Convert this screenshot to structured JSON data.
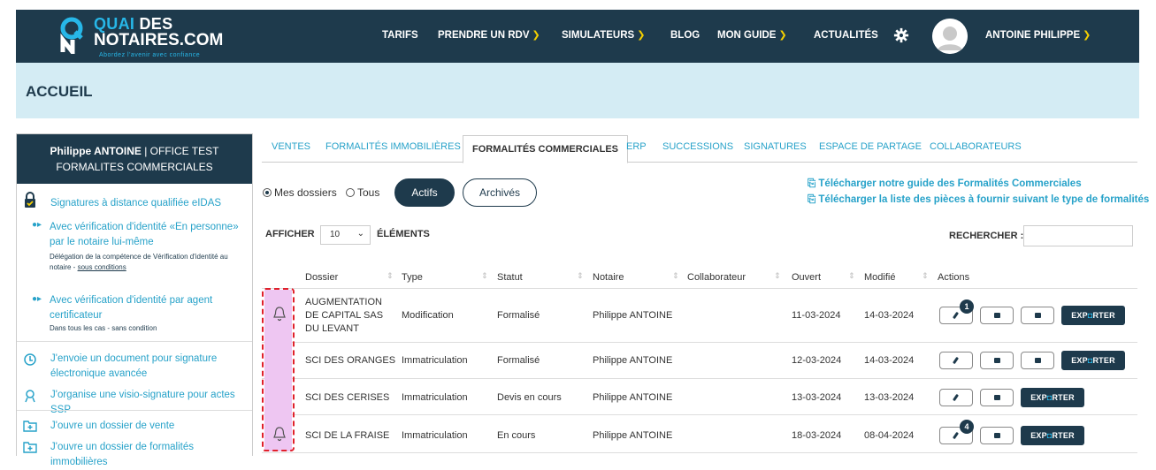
{
  "header": {
    "logo_line1_q": "QUAI",
    "logo_line1_rest": " DES",
    "logo_line2": "NOTAIRES.COM",
    "logo_tagline": "Abordez l'avenir avec confiance",
    "nav": [
      {
        "label": "TARIFS",
        "chevron": false
      },
      {
        "label": "PRENDRE UN RDV",
        "chevron": true
      },
      {
        "label": "SIMULATEURS",
        "chevron": true
      },
      {
        "label": "BLOG",
        "chevron": false
      },
      {
        "label": "MON GUIDE",
        "chevron": true
      },
      {
        "label": "ACTUALITÉS",
        "chevron": false
      }
    ],
    "settings_icon": "gear-icon",
    "user_name": "ANTOINE PHILIPPE",
    "colors": {
      "bar": "#1e3a4c",
      "accent": "#27b7e8",
      "chevron": "#f5d000"
    }
  },
  "banner": {
    "title": "ACCUEIL",
    "color": "#d4ecf4"
  },
  "sidebar": {
    "head_bold": "Philippe ANTOINE",
    "head_rest": " | OFFICE TEST FORMALITES COMMERCIALES",
    "signatures_title": "Signatures à distance qualifiée eIDAS",
    "opt1_title": "Avec vérification d'identité «En personne» par le notaire lui-même",
    "opt1_note_a": "Délégation de la compétence de Vérification d'identité au notaire - ",
    "opt1_note_link": "sous conditions",
    "opt2_title": "Avec vérification d'identité par agent certificateur",
    "opt2_note": "Dans tous les cas - sans condition",
    "link_send": "J'envoie un document pour signature électronique avancée",
    "link_visio": "J'organise une visio-signature pour actes SSP",
    "link_vente": "J'ouvre un dossier de vente",
    "link_formalites": "J'ouvre un dossier de formalités immobilières"
  },
  "tabs": [
    "VENTES",
    "FORMALITÉS IMMOBILIÈRES",
    "FORMALITÉS COMMERCIALES",
    "ERP",
    "SUCCESSIONS",
    "SIGNATURES",
    "ESPACE DE PARTAGE",
    "COLLABORATEURS"
  ],
  "active_tab": "FORMALITÉS COMMERCIALES",
  "filters": {
    "radio_mine": "Mes dossiers",
    "radio_all": "Tous",
    "selected": "Mes dossiers",
    "btn_active": "Actifs",
    "btn_archived": "Archivés"
  },
  "downloads": {
    "guide": "Télécharger notre guide des Formalités Commerciales",
    "pieces": "Télécharger la liste des pièces à fournir suivant le type de formalités"
  },
  "table_controls": {
    "show_label": "AFFICHER",
    "page_size": "10",
    "elements_label": "ÉLÉMENTS",
    "search_label": "RECHERCHER :",
    "search_value": ""
  },
  "table": {
    "headers": [
      "Dossier",
      "Type",
      "Statut",
      "Notaire",
      "Collaborateur",
      "Ouvert",
      "Modifié",
      "Actions"
    ],
    "export_label_a": "EXP",
    "export_label_b": "RTER",
    "rows": [
      {
        "dossier": "AUGMENTATION DE CAPITAL SAS DU LEVANT",
        "type": "Modification",
        "statut": "Formalisé",
        "notaire": "Philippe ANTOINE",
        "collaborateur": "",
        "ouvert": "11-03-2024",
        "modifie": "14-03-2024",
        "bell": true,
        "edit_badge": "1",
        "archive": true
      },
      {
        "dossier": "SCI DES ORANGES",
        "type": "Immatriculation",
        "statut": "Formalisé",
        "notaire": "Philippe ANTOINE",
        "collaborateur": "",
        "ouvert": "12-03-2024",
        "modifie": "14-03-2024",
        "bell": false,
        "edit_badge": "",
        "archive": true
      },
      {
        "dossier": "SCI DES CERISES",
        "type": "Immatriculation",
        "statut": "Devis en cours",
        "notaire": "Philippe ANTOINE",
        "collaborateur": "",
        "ouvert": "13-03-2024",
        "modifie": "13-03-2024",
        "bell": false,
        "edit_badge": "",
        "archive": false
      },
      {
        "dossier": "SCI DE LA FRAISE",
        "type": "Immatriculation",
        "statut": "En cours",
        "notaire": "Philippe ANTOINE",
        "collaborateur": "",
        "ouvert": "18-03-2024",
        "modifie": "08-04-2024",
        "bell": true,
        "edit_badge": "4",
        "archive": false
      }
    ],
    "highlight_color": "#eec6f2",
    "annotation_color": "#e0202b"
  }
}
